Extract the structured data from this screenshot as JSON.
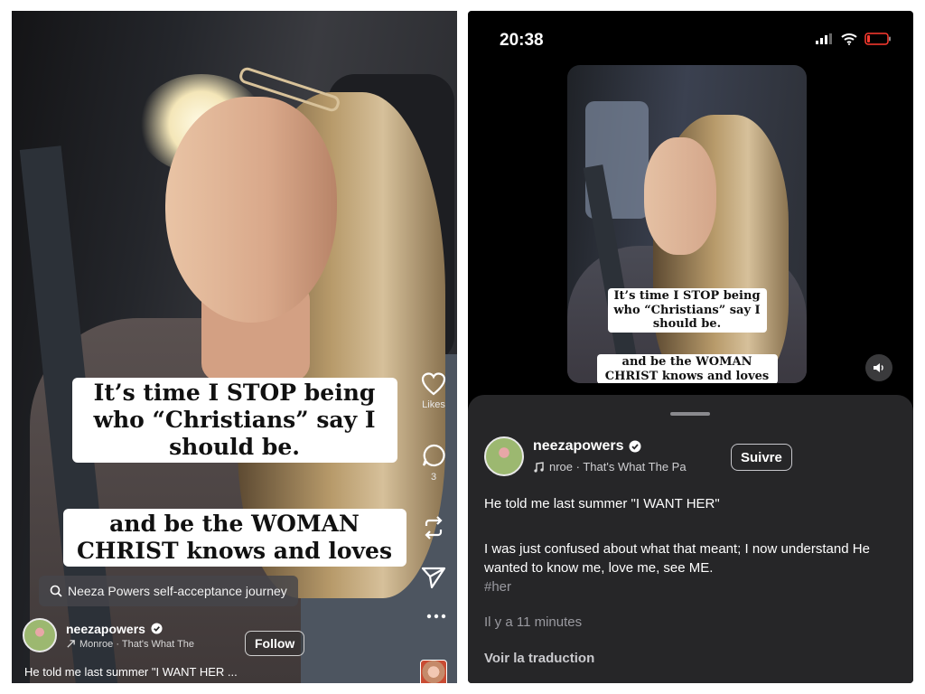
{
  "left": {
    "caption_box_1": "It’s time I STOP being who “Christians” say I should be.",
    "caption_box_2": "and be the WOMAN CHRIST knows and loves",
    "likes_label": "Likes",
    "comments_count": "3",
    "search_text": "Neeza Powers self-acceptance journey",
    "username": "neezapowers",
    "music_text": "Monroe · That's What The",
    "follow_label": "Follow",
    "caption_preview": "He told me last summer \"I WANT HER ..."
  },
  "right": {
    "status_time": "20:38",
    "caption_box_1": "It’s time I STOP being who “Christians” say I should be.",
    "caption_box_2": "and be the WOMAN CHRIST knows and loves",
    "username": "neezapowers",
    "music_text": "nroe · That's What The Pa",
    "follow_label": "Suivre",
    "post_line1": "He told me last summer \"I WANT HER\"",
    "post_para": "I was just confused about what that meant; I now understand He wanted to know me, love me, see ME.",
    "hashtag": "#her",
    "time_ago": "Il y a 11 minutes",
    "translate_label": "Voir la traduction"
  },
  "icons": {
    "heart": "heart-icon",
    "comment": "comment-icon",
    "repost": "repost-icon",
    "share": "send-icon",
    "more": "more-icon",
    "verified": "verified-badge-icon",
    "music": "music-note-icon",
    "mute": "volume-icon"
  },
  "colors": {
    "sheet_bg": "#262628",
    "caption_bg": "#ffffff",
    "text_white": "#ffffff",
    "muted_text": "#9a9aa0"
  }
}
